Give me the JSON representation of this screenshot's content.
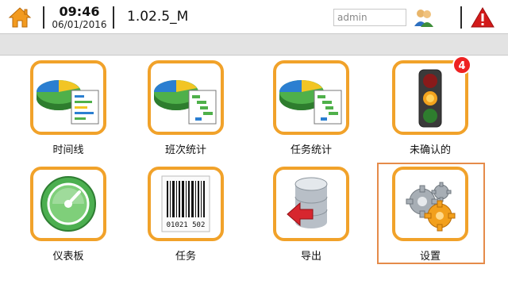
{
  "header": {
    "time": "09:46",
    "date": "06/01/2016",
    "version": "1.02.5_M",
    "user_value": "admin"
  },
  "icons": {
    "home": "home-icon",
    "users": "users-icon",
    "alarm": "alarm-warning-icon"
  },
  "tiles": [
    {
      "label": "时间线",
      "icon": "pie-chart-report-icon"
    },
    {
      "label": "班次统计",
      "icon": "pie-chart-gantt-icon"
    },
    {
      "label": "任务统计",
      "icon": "pie-chart-gantt-icon"
    },
    {
      "label": "未确认的",
      "icon": "traffic-light-icon",
      "badge": "4"
    },
    {
      "label": "仪表板",
      "icon": "gauge-icon"
    },
    {
      "label": "任务",
      "icon": "barcode-icon",
      "barcode_text": "01021 502"
    },
    {
      "label": "导出",
      "icon": "database-export-icon"
    },
    {
      "label": "设置",
      "icon": "gears-icon"
    }
  ],
  "colors": {
    "tile_border": "#f1a22a",
    "selection_border": "#e58b4a",
    "badge": "#e22222",
    "alarm": "#d31a1a",
    "home": "#f29a1f"
  }
}
